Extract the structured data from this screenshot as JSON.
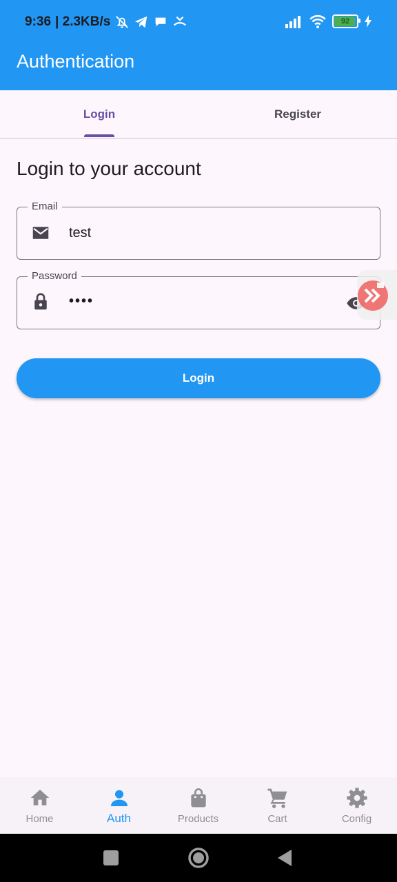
{
  "status_bar": {
    "time": "9:36",
    "network_speed": "| 2.3KB/s",
    "battery_level": "92",
    "icons": [
      "bell-off-icon",
      "telegram-icon",
      "chat-bubble-icon",
      "missed-call-icon",
      "signal-icon",
      "wifi-icon",
      "battery-icon",
      "charging-icon"
    ]
  },
  "app_bar": {
    "title": "Authentication"
  },
  "tabs": [
    {
      "label": "Login",
      "active": true
    },
    {
      "label": "Register",
      "active": false
    }
  ],
  "form": {
    "title": "Login to your account",
    "email": {
      "label": "Email",
      "value": "test",
      "icon": "mail-icon"
    },
    "password": {
      "label": "Password",
      "value": "••••",
      "icon": "lock-icon",
      "toggle_icon": "visibility-icon"
    },
    "submit_label": "Login"
  },
  "bottom_nav": {
    "items": [
      {
        "label": "Home",
        "icon": "home-icon",
        "active": false
      },
      {
        "label": "Auth",
        "icon": "person-icon",
        "active": true
      },
      {
        "label": "Products",
        "icon": "shopping-bag-icon",
        "active": false
      },
      {
        "label": "Cart",
        "icon": "cart-icon",
        "active": false
      },
      {
        "label": "Config",
        "icon": "gear-icon",
        "active": false
      }
    ]
  },
  "colors": {
    "primary": "#2196f3",
    "tab_active": "#6750a4",
    "background": "#fdf7fd",
    "nav_inactive": "#8e8e93"
  }
}
